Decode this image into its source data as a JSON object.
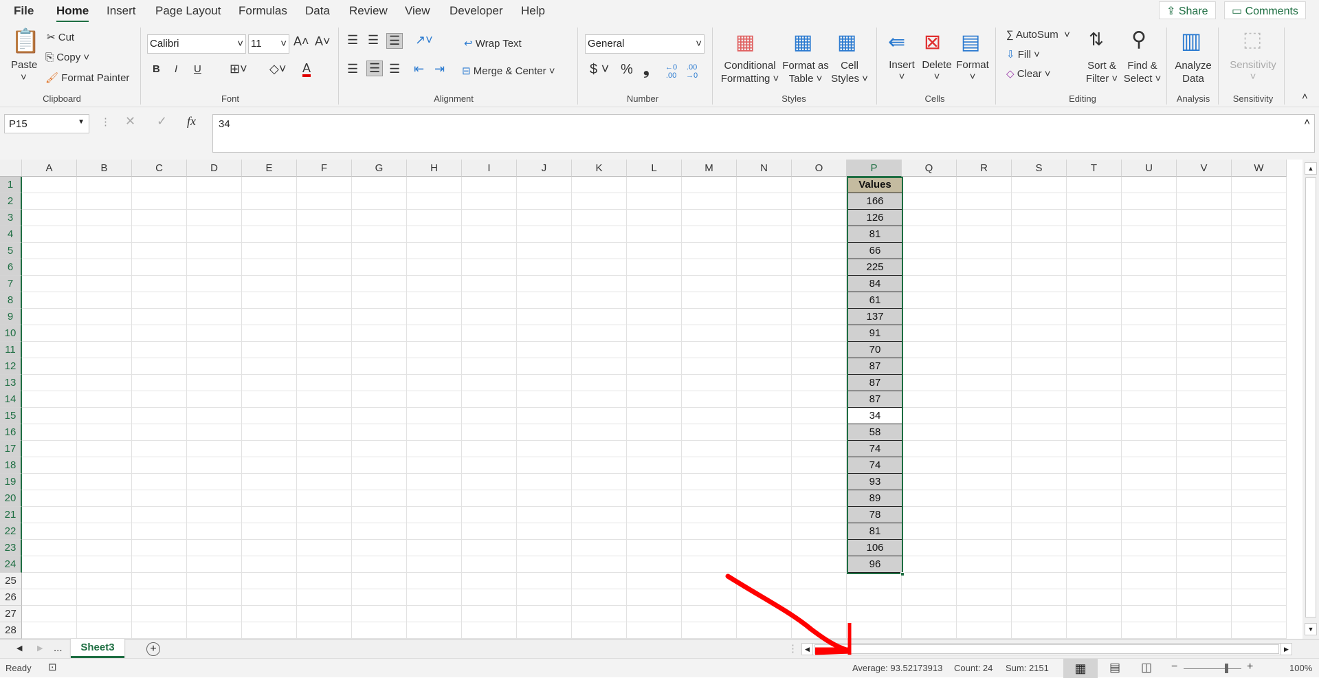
{
  "menu": {
    "tabs": [
      "File",
      "Home",
      "Insert",
      "Page Layout",
      "Formulas",
      "Data",
      "Review",
      "View",
      "Developer",
      "Help"
    ],
    "active": "Home",
    "share": "Share",
    "comments": "Comments"
  },
  "ribbon": {
    "clipboard": {
      "paste": "Paste",
      "cut": "Cut",
      "copy": "Copy",
      "format_painter": "Format Painter",
      "label": "Clipboard"
    },
    "font": {
      "name": "Calibri",
      "size": "11",
      "bold": "B",
      "italic": "I",
      "underline": "U",
      "label": "Font",
      "font_color": "#e00000"
    },
    "alignment": {
      "wrap": "Wrap Text",
      "merge": "Merge & Center",
      "label": "Alignment"
    },
    "number": {
      "format": "General",
      "currency": "$",
      "percent": "%",
      "comma": "❟",
      "label": "Number"
    },
    "styles": {
      "conditional": [
        "Conditional",
        "Formatting ˅"
      ],
      "table": [
        "Format as",
        "Table ˅"
      ],
      "cell": [
        "Cell",
        "Styles ˅"
      ],
      "label": "Styles"
    },
    "cells": {
      "insert": "Insert",
      "delete": "Delete",
      "format": "Format",
      "label": "Cells"
    },
    "editing": {
      "autosum": "AutoSum",
      "fill": "Fill",
      "clear": "Clear",
      "sort": [
        "Sort &",
        "Filter ˅"
      ],
      "find": [
        "Find &",
        "Select ˅"
      ],
      "label": "Editing"
    },
    "analysis": {
      "analyze": [
        "Analyze",
        "Data"
      ],
      "label": "Analysis"
    },
    "sensitivity": {
      "button": "Sensitivity",
      "label": "Sensitivity"
    }
  },
  "formula_bar": {
    "name_box": "P15",
    "fx": "fx",
    "value": "34"
  },
  "sheet": {
    "columns": [
      "A",
      "B",
      "C",
      "D",
      "E",
      "F",
      "G",
      "H",
      "I",
      "J",
      "K",
      "L",
      "M",
      "N",
      "O",
      "P",
      "Q",
      "R",
      "S",
      "T",
      "U",
      "V",
      "W"
    ],
    "row_count": 28,
    "selected_column": "P",
    "active_cell": "P15",
    "values_header": "Values",
    "values": [
      166,
      126,
      81,
      66,
      225,
      84,
      61,
      137,
      91,
      70,
      87,
      87,
      87,
      34,
      58,
      74,
      74,
      93,
      89,
      78,
      81,
      106,
      96
    ]
  },
  "sheet_tabs": {
    "ellipsis": "...",
    "active": "Sheet3",
    "add": "+"
  },
  "status": {
    "ready": "Ready",
    "average": "Average: 93.52173913",
    "count": "Count: 24",
    "sum": "Sum: 2151",
    "zoom": "100%"
  },
  "colors": {
    "accent": "#1e6e42",
    "annotation": "#ff0000",
    "header_fill": "#c4bba0",
    "value_fill": "#d0d0d0"
  }
}
